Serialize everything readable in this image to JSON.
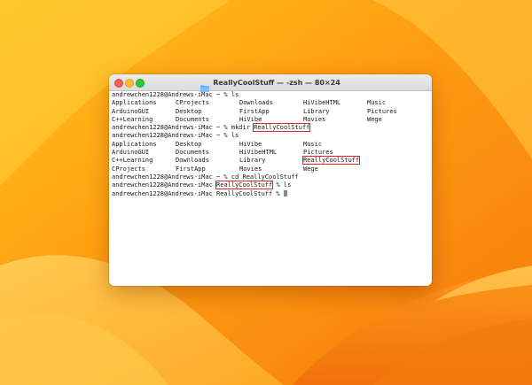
{
  "window": {
    "title": "ReallyCoolStuff — -zsh — 80×24",
    "folder_icon": "folder-icon",
    "colors": {
      "close": "#fe5f57",
      "minimize": "#febc2e",
      "zoom": "#28c840",
      "highlight": "#e0242a"
    }
  },
  "terminal": {
    "prompt1": "andrewchen1228@Andrews-iMac ~ % ls",
    "ls1": [
      [
        "Applications",
        "CProjects",
        "Downloads",
        "HiVibeHTML",
        "Music"
      ],
      [
        "ArduinoGUI",
        "Desktop",
        "FirstApp",
        "Library",
        "Pictures"
      ],
      [
        "C++Learning",
        "Documents",
        "HiVibe",
        "Movies",
        "Wege"
      ]
    ],
    "prompt2": {
      "prefix": "andrewchen1228@Andrews-iMac ~ % mkdir ",
      "arg": "ReallyCoolStuff"
    },
    "prompt3": "andrewchen1228@Andrews-iMac ~ % ls",
    "ls2": [
      [
        "Applications",
        "Desktop",
        "HiVibe",
        "Music"
      ],
      [
        "ArduinoGUI",
        "Documents",
        "HiVibeHTML",
        "Pictures"
      ],
      [
        "C++Learning",
        "Downloads",
        "Library",
        "ReallyCoolStuff"
      ],
      [
        "CProjects",
        "FirstApp",
        "Movies",
        "Wege"
      ]
    ],
    "prompt4": "andrewchen1228@Andrews-iMac ~ % cd ReallyCoolStuff",
    "prompt5": {
      "prefix": "andrewchen1228@Andrews-iMac ",
      "dir": "ReallyCoolStuff",
      "suffix": " % ls"
    },
    "prompt6": "andrewchen1228@Andrews-iMac ReallyCoolStuff % "
  }
}
